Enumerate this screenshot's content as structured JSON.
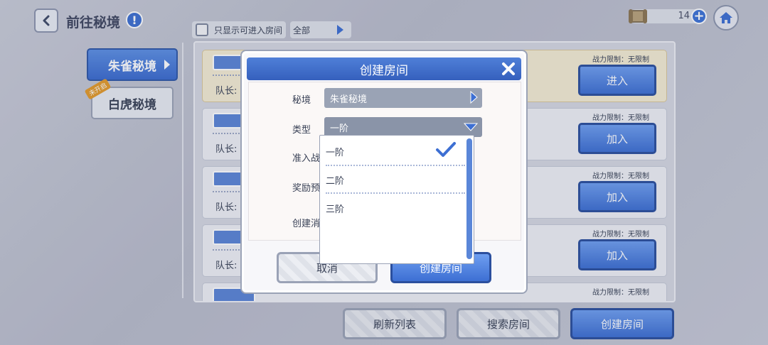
{
  "header": {
    "title": "前往秘境",
    "info_glyph": "!",
    "currency_count": "14",
    "plus_glyph": "+"
  },
  "filter": {
    "only_enterable_label": "只显示可进入房间",
    "select_value": "全部"
  },
  "side_tabs": [
    {
      "label": "朱雀秘境",
      "active": true
    },
    {
      "label": "白虎秘境",
      "active": false,
      "badge": "未开启"
    }
  ],
  "rooms": [
    {
      "leader_label": "队长:",
      "power_limit": "战力限制：无限制",
      "action": "进入"
    },
    {
      "leader_label": "队长:",
      "power_limit": "战力限制：无限制",
      "action": "加入"
    },
    {
      "leader_label": "队长:",
      "power_limit": "战力限制：无限制",
      "action": "加入"
    },
    {
      "leader_label": "队长:",
      "power_limit": "战力限制：无限制",
      "action": "加入"
    },
    {
      "leader_label": "",
      "power_limit": "战力限制：无限制",
      "action": ""
    }
  ],
  "bottom_buttons": {
    "refresh": "刷新列表",
    "search": "搜索房间",
    "create": "创建房间"
  },
  "dialog": {
    "title": "创建房间",
    "fields": {
      "realm_label": "秘境",
      "realm_value": "朱雀秘境",
      "type_label": "类型",
      "type_value": "一阶",
      "power_label": "准入战",
      "reward_label": "奖励预",
      "cost_label": "创建消"
    },
    "cancel": "取消",
    "create": "创建房间"
  },
  "dropdown": {
    "options": [
      "一阶",
      "二阶",
      "三阶"
    ],
    "selected_index": 0
  },
  "colors": {
    "accent_blue": "#3d6fd3",
    "panel": "#d5d8e2",
    "first_card": "#f4ecd3"
  }
}
